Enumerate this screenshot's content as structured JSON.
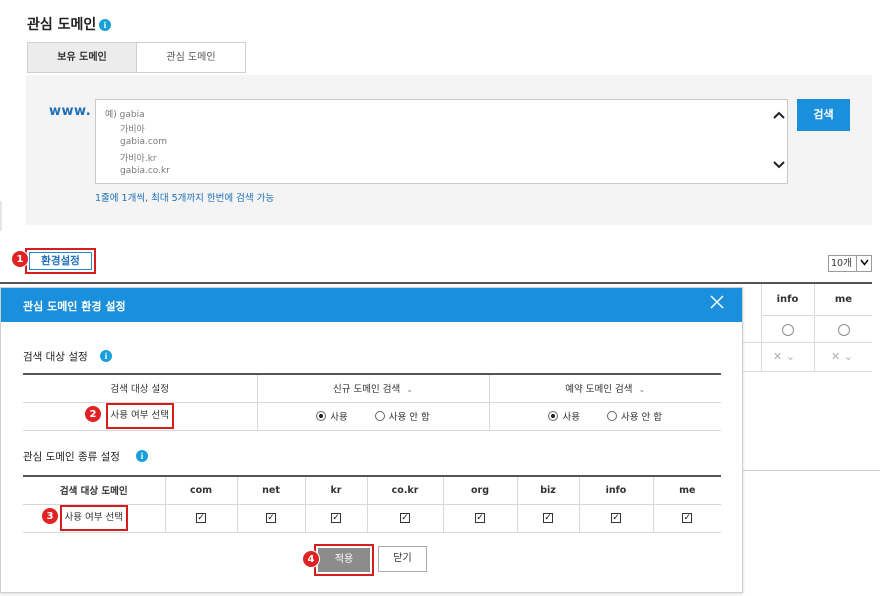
{
  "header": {
    "title": "관심 도메인",
    "info_icon": "i"
  },
  "tabs": [
    {
      "label": "보유 도메인",
      "active": true
    },
    {
      "label": "관심 도메인",
      "active": false
    }
  ],
  "search": {
    "prefix": "www.",
    "placeholder_lines": [
      "예) gabia",
      "가비아",
      "gabia.com",
      "가비아.kr",
      "gabia.co.kr"
    ],
    "button_label": "검색",
    "hint": "1줄에 1개씩, 최대 5개까지 한번에 검색 가능"
  },
  "settings_button": {
    "label": "환경설정"
  },
  "page_size": {
    "value": "10개"
  },
  "background_table": {
    "columns": [
      "info",
      "me"
    ],
    "row_marks": [
      "○",
      "○"
    ],
    "row2_marks": [
      "✕ ⌄",
      "✕ ⌄"
    ]
  },
  "steps": [
    "1",
    "2",
    "3",
    "4"
  ],
  "modal": {
    "title": "관심 도메인 환경 설정",
    "close_icon": "✕",
    "search_target": {
      "section_title": "검색 대상 설정",
      "headers": [
        "검색 대상 설정",
        "신규 도메인 검색",
        "예약 도메인 검색"
      ],
      "row_label": "사용 여부 선택",
      "new_domain": {
        "use_label": "사용",
        "no_use_label": "사용 안 함",
        "selected": "use"
      },
      "reserved_domain": {
        "use_label": "사용",
        "no_use_label": "사용 안 함",
        "selected": "use"
      }
    },
    "domain_types": {
      "section_title": "관심 도메인 종류 설정",
      "target_header": "검색 대상 도메인",
      "columns": [
        "com",
        "net",
        "kr",
        "co.kr",
        "org",
        "biz",
        "info",
        "me"
      ],
      "row_label": "사용 여부 선택",
      "checked": [
        true,
        true,
        true,
        true,
        true,
        true,
        true,
        true
      ]
    },
    "apply_label": "적용",
    "close_label": "닫기"
  },
  "colors": {
    "accent": "#1a8fdc",
    "highlight": "#d41d1d",
    "link": "#1d6fb8"
  }
}
